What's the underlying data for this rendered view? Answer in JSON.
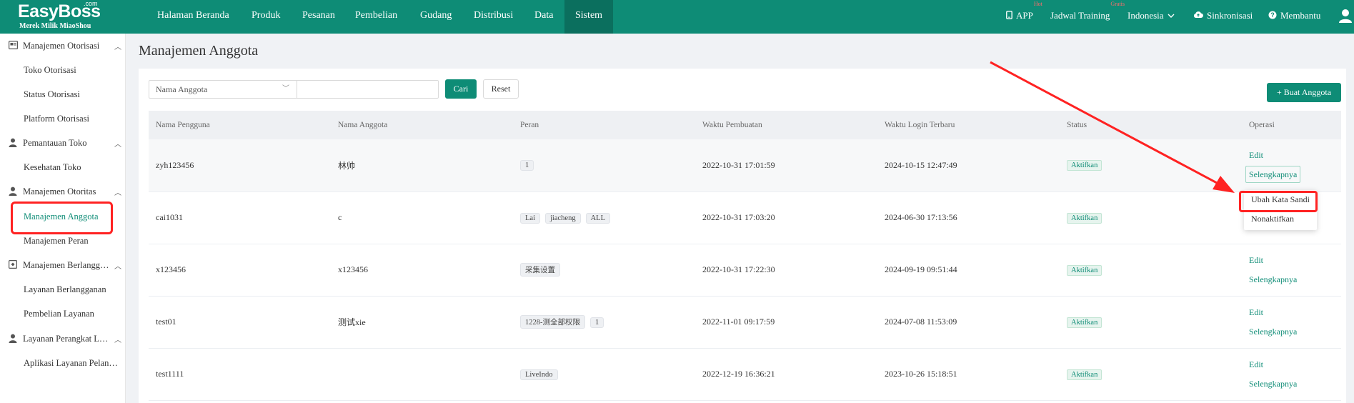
{
  "brand": {
    "name": "EasyBoss",
    "suffix": ".com",
    "subtitle": "Merek Milik MiaoShou"
  },
  "nav": {
    "items": [
      "Halaman Beranda",
      "Produk",
      "Pesanan",
      "Pembelian",
      "Gudang",
      "Distribusi",
      "Data",
      "Sistem"
    ],
    "active": "Sistem",
    "right": {
      "app": "APP",
      "app_badge": "Hot",
      "training": "Jadwal Training",
      "training_badge": "Gratis",
      "language": "Indonesia",
      "sync": "Sinkronisasi",
      "help": "Membantu"
    }
  },
  "sidebar": {
    "groups": [
      {
        "label": "Manajemen Otorisasi",
        "items": [
          "Toko Otorisasi",
          "Status Otorisasi",
          "Platform Otorisasi"
        ]
      },
      {
        "label": "Pemantauan Toko",
        "items": [
          "Kesehatan Toko"
        ]
      },
      {
        "label": "Manajemen Otoritas",
        "items": [
          "Manajemen Anggota",
          "Manajemen Peran"
        ]
      },
      {
        "label": "Manajemen Berlangganan",
        "items": [
          "Layanan Berlangganan",
          "Pembelian Layanan"
        ]
      },
      {
        "label": "Layanan Perangkat Lunak",
        "items": [
          "Aplikasi Layanan Pelanggan"
        ]
      }
    ],
    "active_item": "Manajemen Anggota"
  },
  "page": {
    "title": "Manajemen Anggota",
    "filter_select": "Nama Anggota",
    "search_value": "",
    "search_button": "Cari",
    "reset_button": "Reset",
    "create_button": "+ Buat Anggota"
  },
  "table": {
    "columns": [
      "Nama Pengguna",
      "Nama Anggota",
      "Peran",
      "Waktu Pembuatan",
      "Waktu Login Terbaru",
      "Status",
      "Operasi"
    ],
    "rows": [
      {
        "username": "zyh123456",
        "member": "林帅",
        "roles": [
          "1"
        ],
        "created": "2022-10-31 17:01:59",
        "last_login": "2024-10-15 12:47:49",
        "status": "Aktifkan"
      },
      {
        "username": "cai1031",
        "member": "c",
        "roles": [
          "Lai",
          "jiacheng",
          "ALL"
        ],
        "created": "2022-10-31 17:03:20",
        "last_login": "2024-06-30 17:13:56",
        "status": "Aktifkan"
      },
      {
        "username": "x123456",
        "member": "x123456",
        "roles": [
          "采集设置"
        ],
        "created": "2022-10-31 17:22:30",
        "last_login": "2024-09-19 09:51:44",
        "status": "Aktifkan"
      },
      {
        "username": "test01",
        "member": "测试xie",
        "roles": [
          "1228-测全部权限",
          "1"
        ],
        "created": "2022-11-01 09:17:59",
        "last_login": "2024-07-08 11:53:09",
        "status": "Aktifkan"
      },
      {
        "username": "test1111",
        "member": "",
        "roles": [
          "LiveIndo"
        ],
        "created": "2022-12-19 16:36:21",
        "last_login": "2023-10-26 15:18:51",
        "status": "Aktifkan"
      }
    ],
    "op_edit": "Edit",
    "op_more": "Selengkapnya"
  },
  "dropdown": {
    "items": [
      "Ubah Kata Sandi",
      "Nonaktifkan"
    ]
  },
  "colors": {
    "brand": "#0e8c76",
    "annotation": "#ff2222"
  },
  "icons": [
    "phone-icon",
    "cloud-sync-icon",
    "help-icon",
    "user-icon",
    "chevron-down-icon",
    "chevron-up-icon",
    "plus-icon"
  ]
}
